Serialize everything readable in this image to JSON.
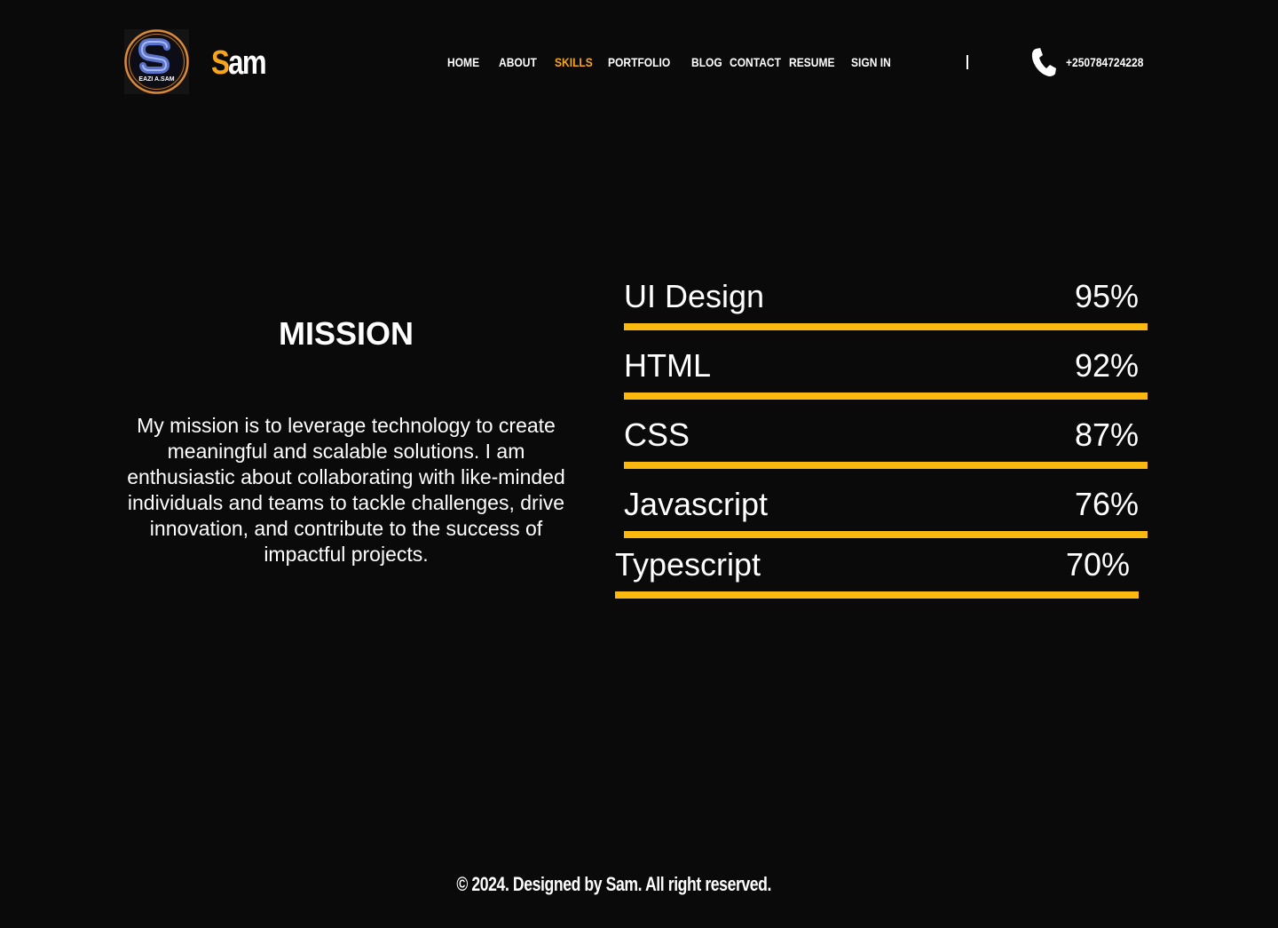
{
  "header": {
    "logo": {
      "letter": "S",
      "caption": "EAZI A.SAM",
      "icon": "brand-logo-icon",
      "ring_color": "#d98a3a"
    },
    "brand": {
      "first_letter": "S",
      "rest": "am"
    },
    "nav": [
      {
        "label": "HOME",
        "active": false
      },
      {
        "label": "ABOUT",
        "active": false
      },
      {
        "label": "SKILLS",
        "active": true
      },
      {
        "label": "PORTFOLIO",
        "active": false
      },
      {
        "label": "BLOG",
        "active": false
      },
      {
        "label": "CONTACT",
        "active": false
      },
      {
        "label": "RESUME",
        "active": false
      },
      {
        "label": "SIGN IN",
        "active": false
      }
    ],
    "phone": {
      "icon": "phone-icon",
      "number": "+250784724228"
    }
  },
  "mission": {
    "title": "MISSION",
    "text": "My mission is to leverage technology to create meaningful and scalable solutions. I am enthusiastic about collaborating with like-minded individuals and teams to tackle challenges, drive innovation, and contribute to the success of impactful projects."
  },
  "skills": [
    {
      "name": "UI Design",
      "percent_label": "95%",
      "level": 1.0
    },
    {
      "name": "HTML",
      "percent_label": "92%",
      "level": 1.0
    },
    {
      "name": "CSS",
      "percent_label": "87%",
      "level": 1.0
    },
    {
      "name": "Javascript",
      "percent_label": "76%",
      "level": 1.0
    },
    {
      "name": "Typescript",
      "percent_label": "70%",
      "level": 1.0
    }
  ],
  "footer": {
    "text": "© 2024. Designed by Sam. All right reserved."
  },
  "colors": {
    "background": "#0a0a0a",
    "accent": "#f7a51c",
    "bar": "#fbb80f",
    "text": "#ffffff"
  }
}
